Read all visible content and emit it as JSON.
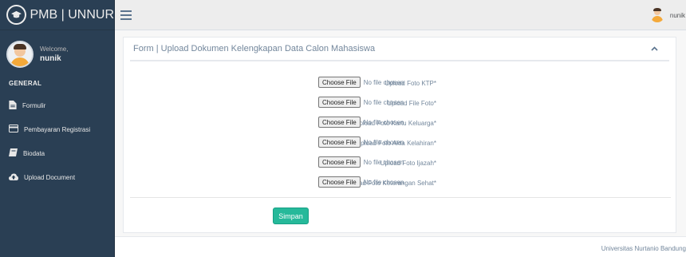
{
  "brand": {
    "title": "PMB | UNNUR",
    "icon": "graduation-cap-icon"
  },
  "profile": {
    "welcome": "Welcome,",
    "username": "nunik"
  },
  "sidebar": {
    "section_title": "GENERAL",
    "items": [
      {
        "label": "Formulir",
        "icon": "file-text-icon"
      },
      {
        "label": "Pembayaran Registrasi",
        "icon": "credit-card-icon"
      },
      {
        "label": "Biodata",
        "icon": "book-icon"
      },
      {
        "label": "Upload Document",
        "icon": "cloud-upload-icon"
      }
    ]
  },
  "topbar": {
    "toggle_icon": "hamburger-menu-icon",
    "user_name": "nunik"
  },
  "panel": {
    "title": "Form | Upload Dokumen Kelengkapan Data Calon Mahasiswa",
    "collapse_icon": "chevron-up-icon",
    "file_button_label": "Choose File",
    "fields": [
      {
        "label": "Upload Foto KTP*",
        "status": "No file chosen"
      },
      {
        "label": "Upload File Foto*",
        "status": "No file chosen"
      },
      {
        "label": "Upload Foto Kartu Keluarga*",
        "status": "No file chosen"
      },
      {
        "label": "Upload Foto Akta Kelahiran*",
        "status": "No file chosen"
      },
      {
        "label": "Upload Foto Ijazah*",
        "status": "No file chosen"
      },
      {
        "label": "Upload Foto Keterangan Sehat*",
        "status": "No file chosen"
      }
    ],
    "submit_label": "Simpan"
  },
  "footer": {
    "text": "Universitas Nurtanio Bandung"
  },
  "colors": {
    "sidebar_bg": "#2a3f54",
    "accent_green": "#26b99a",
    "text_muted": "#73879c"
  }
}
